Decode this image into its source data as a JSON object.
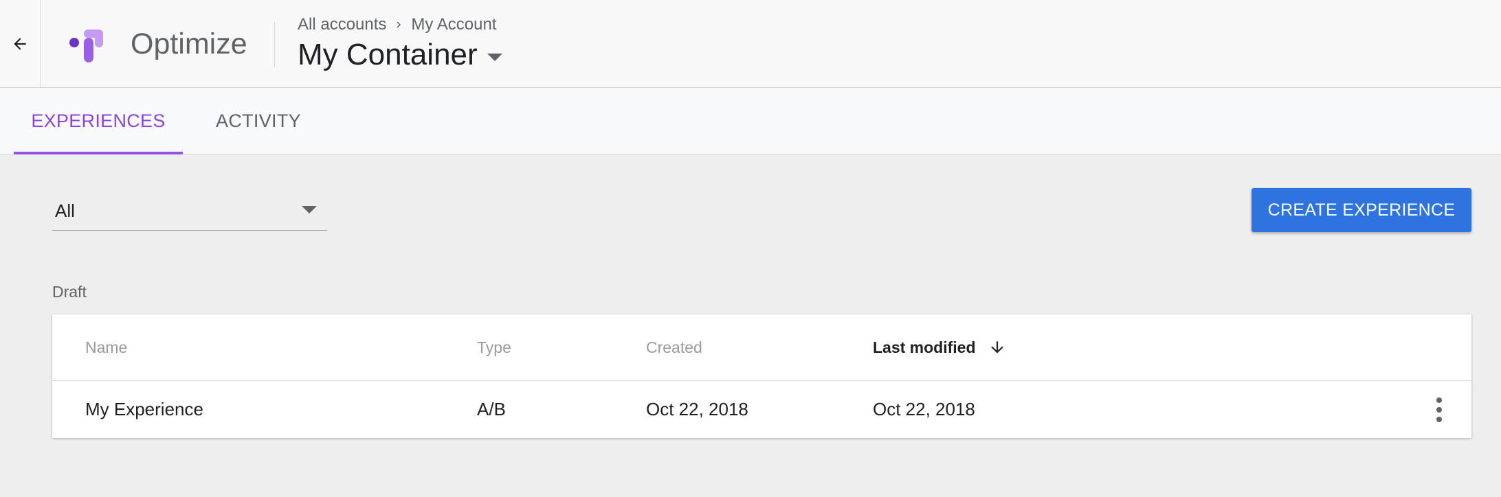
{
  "header": {
    "product_name": "Optimize",
    "breadcrumb": [
      "All accounts",
      "My Account"
    ],
    "container_name": "My Container"
  },
  "tabs": [
    {
      "label": "EXPERIENCES",
      "active": true
    },
    {
      "label": "ACTIVITY",
      "active": false
    }
  ],
  "filter": {
    "selected": "All"
  },
  "actions": {
    "create_label": "CREATE EXPERIENCE"
  },
  "section": {
    "label": "Draft"
  },
  "table": {
    "columns": [
      "Name",
      "Type",
      "Created",
      "Last modified"
    ],
    "sorted_column": "Last modified",
    "sort_direction": "descending",
    "rows": [
      {
        "name": "My Experience",
        "type": "A/B",
        "created": "Oct 22, 2018",
        "last_modified": "Oct 22, 2018"
      }
    ]
  },
  "colors": {
    "accent_purple": "#9b51e0",
    "primary_blue": "#2f73e0",
    "background": "#eeeeee"
  },
  "icons": [
    "arrow-back-icon",
    "optimize-logo-icon",
    "chevron-right-icon",
    "arrow-down-icon",
    "more-vert-icon"
  ]
}
